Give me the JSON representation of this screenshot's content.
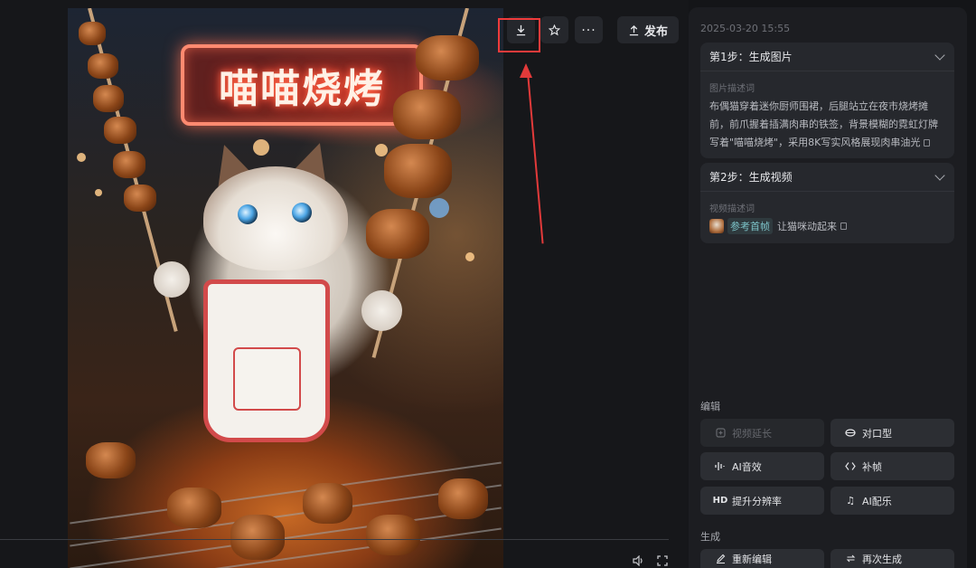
{
  "viewer": {
    "sign_text": "喵喵烧烤",
    "toolbar": {
      "download_icon": "download-icon",
      "star_icon": "star-icon",
      "more_icon": "more-icon",
      "publish_label": "发布"
    },
    "controls": {
      "volume_icon": "volume-icon",
      "fullscreen_icon": "fullscreen-icon"
    }
  },
  "panel": {
    "timestamp": "2025-03-20 15:55",
    "step1": {
      "title": "第1步：生成图片",
      "desc_label": "图片描述词",
      "desc_text": "布偶猫穿着迷你厨师围裙，后腿站立在夜市烧烤摊前，前爪握着插满肉串的铁签，背景模糊的霓虹灯牌写着\"喵喵烧烤\"，采用8K写实风格展现肉串油光"
    },
    "step2": {
      "title": "第2步：生成视频",
      "desc_label": "视频描述词",
      "ref_chip": "参考首帧",
      "desc_text": "让猫咪动起来"
    },
    "edit_section": {
      "label": "编辑",
      "buttons": [
        {
          "label": "视频延长",
          "icon": "extend-icon",
          "disabled": true
        },
        {
          "label": "对口型",
          "icon": "lips-icon",
          "disabled": false
        },
        {
          "label": "AI音效",
          "icon": "waveform-icon",
          "disabled": false
        },
        {
          "label": "补帧",
          "icon": "diamond-icon",
          "disabled": false
        },
        {
          "label": "提升分辨率",
          "icon": "hd-icon",
          "disabled": false
        },
        {
          "label": "AI配乐",
          "icon": "music-note-icon",
          "disabled": false
        }
      ]
    },
    "generate_section": {
      "label": "生成",
      "buttons": [
        {
          "label": "重新编辑",
          "icon": "pencil-icon"
        },
        {
          "label": "再次生成",
          "icon": "regenerate-icon"
        }
      ]
    }
  }
}
